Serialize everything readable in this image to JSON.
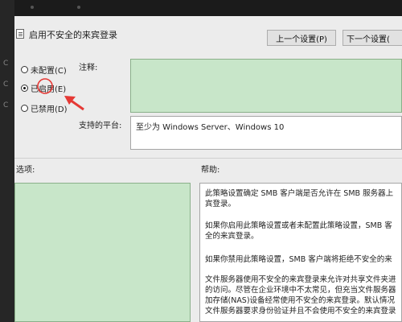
{
  "left_strip": {
    "chars": [
      "C",
      "C",
      "C"
    ]
  },
  "window": {
    "title": "启用不安全的来宾登录",
    "buttons": {
      "prev": "上一个设置(P)",
      "next": "下一个设置("
    }
  },
  "radios": [
    {
      "label": "未配置(C)",
      "checked": false
    },
    {
      "label": "已启用(E)",
      "checked": true
    },
    {
      "label": "已禁用(D)",
      "checked": false
    }
  ],
  "comment": {
    "label": "注释:"
  },
  "platform": {
    "label": "支持的平台:",
    "value": "至少为 Windows Server、Windows 10"
  },
  "options": {
    "label": "选项:"
  },
  "help": {
    "label": "帮助:",
    "paragraphs": [
      "此策略设置确定 SMB 客户端是否允许在 SMB 服务器上\n宾登录。",
      "如果你启用此策略设置或者未配置此策略设置，SMB 客\n全的来宾登录。",
      "如果你禁用此策略设置，SMB 客户端将拒绝不安全的来",
      "文件服务器使用不安全的来宾登录来允许对共享文件夹进\n的访问。尽管在企业环境中不太常见，但充当文件服务器\n加存储(NAS)设备经常使用不安全的来宾登录。默认情况\n文件服务器要求身份验证并且不会使用不安全的来宾登录"
    ]
  },
  "colors": {
    "green_box": "#c8e6c9",
    "annotation": "#e53935"
  }
}
